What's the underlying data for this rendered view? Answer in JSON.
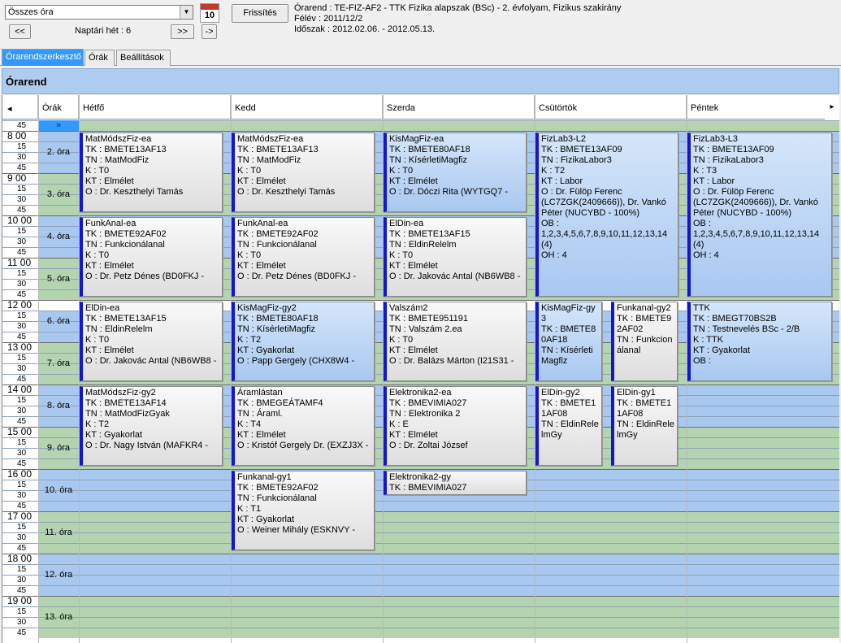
{
  "toolbar": {
    "view_select": "Összes óra",
    "calendar_day": "10",
    "refresh_label": "Frissítés",
    "prev_label": "<<",
    "week_label": "Naptári hét : 6",
    "next_label": ">>",
    "goto_label": "->"
  },
  "info": {
    "line1": "Órarend : TE-FIZ-AF2 - TTK Fizika alapszak (BSc) - 2. évfolyam, Fizikus szakirány",
    "line2": "Félév : 2011/12/2",
    "line3": "Időszak : 2012.02.06. - 2012.05.13."
  },
  "tabs": [
    "Órarendszerkesztő",
    "Órák",
    "Beállítások"
  ],
  "panel_title": "Órarend",
  "grid": {
    "scroll_left": "◂",
    "scroll_right": "▸",
    "collapse_mark": "»",
    "periods_header": "Órák",
    "days": [
      "Hétfő",
      "Kedd",
      "Szerda",
      "Csütörtök",
      "Péntek"
    ],
    "time_labels": [
      {
        "t": "45"
      },
      {
        "t": "8 00"
      },
      {
        "t": "15"
      },
      {
        "t": "30"
      },
      {
        "t": "45"
      },
      {
        "t": "9 00"
      },
      {
        "t": "15"
      },
      {
        "t": "30"
      },
      {
        "t": "45"
      },
      {
        "t": "10 00"
      },
      {
        "t": "15"
      },
      {
        "t": "30"
      },
      {
        "t": "45"
      },
      {
        "t": "11 00"
      },
      {
        "t": "15"
      },
      {
        "t": "30"
      },
      {
        "t": "45"
      },
      {
        "t": "12 00"
      },
      {
        "t": "15"
      },
      {
        "t": "30"
      },
      {
        "t": "45"
      },
      {
        "t": "13 00"
      },
      {
        "t": "15"
      },
      {
        "t": "30"
      },
      {
        "t": "45"
      },
      {
        "t": "14 00"
      },
      {
        "t": "15"
      },
      {
        "t": "30"
      },
      {
        "t": "45"
      },
      {
        "t": "15 00"
      },
      {
        "t": "15"
      },
      {
        "t": "30"
      },
      {
        "t": "45"
      },
      {
        "t": "16 00"
      },
      {
        "t": "15"
      },
      {
        "t": "30"
      },
      {
        "t": "45"
      },
      {
        "t": "17 00"
      },
      {
        "t": "15"
      },
      {
        "t": "30"
      },
      {
        "t": "45"
      },
      {
        "t": "18 00"
      },
      {
        "t": "15"
      },
      {
        "t": "30"
      },
      {
        "t": "45"
      },
      {
        "t": "19 00"
      },
      {
        "t": "15"
      },
      {
        "t": "30"
      },
      {
        "t": "45"
      }
    ],
    "periods": [
      "2. óra",
      "3. óra",
      "4. óra",
      "5. óra",
      "6. óra",
      "7. óra",
      "8. óra",
      "9. óra",
      "10. óra",
      "11. óra",
      "12. óra",
      "13. óra"
    ]
  },
  "events": [
    {
      "day": 0,
      "start": 8,
      "end": 10,
      "style": "",
      "lines": [
        "MatMódszFiz-ea",
        "TK : BMETE13AF13",
        "TN : MatModFiz",
        "K : T0",
        "KT : Elmélet",
        "O :  Dr. Keszthelyi Tamás"
      ]
    },
    {
      "day": 1,
      "start": 8,
      "end": 10,
      "style": "",
      "lines": [
        "MatMódszFiz-ea",
        "TK : BMETE13AF13",
        "TN : MatModFiz",
        "K : T0",
        "KT : Elmélet",
        "O :  Dr. Keszthelyi Tamás"
      ]
    },
    {
      "day": 2,
      "start": 8,
      "end": 10,
      "style": "blue",
      "lines": [
        "KisMagFiz-ea",
        "TK : BMETE80AF18",
        "TN : KísérletiMagfiz",
        "K : T0",
        "KT : Elmélet",
        "O :  Dr. Dóczi  Rita (WYTGQ7 -"
      ]
    },
    {
      "day": 3,
      "start": 8,
      "end": 12,
      "style": "blue wrapw",
      "lines": [
        "FizLab3-L2",
        "TK : BMETE13AF09",
        "TN : FizikaLabor3",
        "K : T2",
        "KT : Labor",
        "O :  Dr. Fülöp Ferenc (LC7ZGK(2409666)), Dr. Vankó Péter (NUCYBD - 100%)",
        "OB : 1,2,3,4,5,6,7,8,9,10,11,12,13,14 (4)",
        "OH : 4"
      ]
    },
    {
      "day": 4,
      "start": 8,
      "end": 12,
      "style": "blue wrapw",
      "lines": [
        "FizLab3-L3",
        "TK : BMETE13AF09",
        "TN : FizikaLabor3",
        "K : T3",
        "KT : Labor",
        "O :  Dr. Fülöp Ferenc (LC7ZGK(2409666)), Dr. Vankó Péter (NUCYBD - 100%)",
        "OB : 1,2,3,4,5,6,7,8,9,10,11,12,13,14 (4)",
        "OH : 4"
      ]
    },
    {
      "day": 0,
      "start": 10,
      "end": 12,
      "style": "",
      "lines": [
        "FunkAnal-ea",
        "TK : BMETE92AF02",
        "TN : Funkcionálanal",
        "K : T0",
        "KT : Elmélet",
        "O :  Dr. Petz Dénes (BD0FKJ -"
      ]
    },
    {
      "day": 1,
      "start": 10,
      "end": 12,
      "style": "",
      "lines": [
        "FunkAnal-ea",
        "TK : BMETE92AF02",
        "TN : Funkcionálanal",
        "K : T0",
        "KT : Elmélet",
        "O :  Dr. Petz Dénes (BD0FKJ -"
      ]
    },
    {
      "day": 2,
      "start": 10,
      "end": 12,
      "style": "",
      "lines": [
        "ElDin-ea",
        "TK : BMETE13AF15",
        "TN : EldinRelelm",
        "K : T0",
        "KT : Elmélet",
        "O :  Dr. Jakovác Antal (NB6WB8 -"
      ]
    },
    {
      "day": 0,
      "start": 12,
      "end": 14,
      "style": "",
      "lines": [
        "ElDin-ea",
        "TK : BMETE13AF15",
        "TN : EldinRelelm",
        "K : T0",
        "KT : Elmélet",
        "O :  Dr. Jakovác Antal (NB6WB8 -"
      ]
    },
    {
      "day": 1,
      "start": 12,
      "end": 14,
      "style": "blue",
      "lines": [
        "KisMagFiz-gy2",
        "TK : BMETE80AF18",
        "TN : KísérletiMagfiz",
        "K : T2",
        "KT : Gyakorlat",
        "O :  Papp Gergely (CHX8W4 -"
      ]
    },
    {
      "day": 2,
      "start": 12,
      "end": 14,
      "style": "",
      "lines": [
        "Valszám2",
        "TK : BMETE951191",
        "TN : Valszám 2.ea",
        "K : T0",
        "KT : Elmélet",
        "O :  Dr. Balázs Márton (I21S31 -"
      ]
    },
    {
      "day": 3,
      "start": 12,
      "end": 14,
      "half": 0,
      "style": "blue wrap",
      "lines": [
        "KisMagFiz-gy3",
        "TK : BMETE80AF18",
        "TN : KísérletiMagfiz"
      ]
    },
    {
      "day": 3,
      "start": 12,
      "end": 14,
      "half": 1,
      "style": "wrap",
      "lines": [
        "Funkanal-gy2",
        "TK : BMETE92AF02",
        "TN : Funkcionálanal"
      ]
    },
    {
      "day": 4,
      "start": 12,
      "end": 14,
      "style": "blue",
      "lines": [
        "TTK",
        "TK : BMEGT70BS2B",
        "TN : Testnevelés BSc - 2/B",
        "K : TTK",
        "KT : Gyakorlat",
        "OB :"
      ]
    },
    {
      "day": 0,
      "start": 14,
      "end": 16,
      "style": "",
      "lines": [
        "MatMódszFiz-gy2",
        "TK : BMETE13AF14",
        "TN : MatModFizGyak",
        "K : T2",
        "KT : Gyakorlat",
        "O :  Dr. Nagy István (MAFKR4 -"
      ]
    },
    {
      "day": 1,
      "start": 14,
      "end": 16,
      "style": "",
      "lines": [
        "Áramlástan",
        "TK : BMEGEÁTAMF4",
        "TN : Áraml.",
        "K : T4",
        "KT : Elmélet",
        "O :  Kristóf Gergely Dr. (EXZJ3X -"
      ]
    },
    {
      "day": 2,
      "start": 14,
      "end": 16,
      "style": "",
      "lines": [
        "Elektronika2-ea",
        "TK : BMEVIMIA027",
        "TN : Elektronika 2",
        "K : E",
        "KT : Elmélet",
        "O :  Dr. Zoltai József"
      ]
    },
    {
      "day": 3,
      "start": 14,
      "end": 16,
      "half": 0,
      "style": "wrap",
      "lines": [
        "ElDin-gy2",
        "TK : BMETE11AF08",
        "TN : EldinRelelmGy"
      ]
    },
    {
      "day": 3,
      "start": 14,
      "end": 16,
      "half": 1,
      "style": "wrap",
      "lines": [
        "ElDin-gy1",
        "TK : BMETE11AF08",
        "TN : EldinRelelmGy"
      ]
    },
    {
      "day": 1,
      "start": 16,
      "end": 18,
      "style": "",
      "lines": [
        "Funkanal-gy1",
        "TK : BMETE92AF02",
        "TN : Funkcionálanal",
        "K : T1",
        "KT : Gyakorlat",
        "O :  Weiner Mihály (ESKNVY -"
      ]
    },
    {
      "day": 2,
      "start": 16,
      "end": 16.7,
      "style": "",
      "lines": [
        "Elektronika2-gy",
        "TK : BMEVIMIA027"
      ]
    }
  ],
  "colors": {
    "period_blue": "#a9c8f0",
    "period_green": "#b4d4b0",
    "event_border": "#1414d4",
    "title_bg": "#aecbf0",
    "tab_active": "#3399ff"
  }
}
